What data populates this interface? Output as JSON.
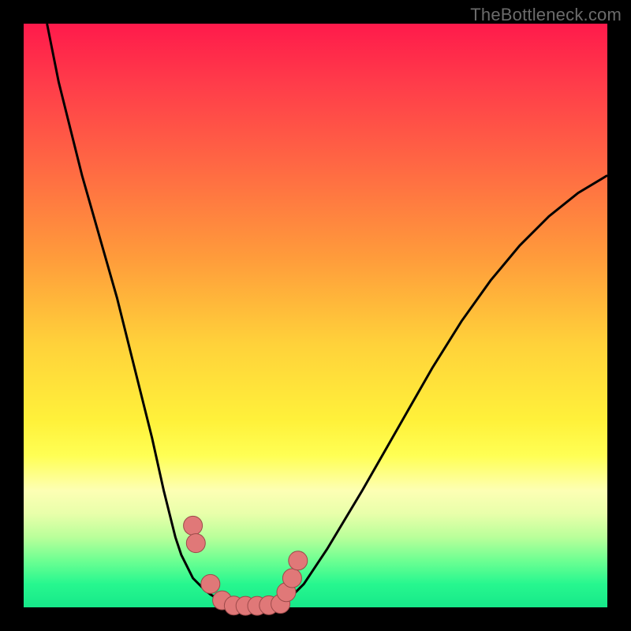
{
  "watermark": {
    "text": "TheBottleneck.com"
  },
  "chart_data": {
    "type": "line",
    "title": "",
    "xlabel": "",
    "ylabel": "",
    "xlim": [
      0,
      100
    ],
    "ylim": [
      0,
      100
    ],
    "grid": false,
    "series": [
      {
        "name": "left-curve",
        "x": [
          4,
          6,
          8,
          10,
          12,
          14,
          16,
          18,
          20,
          22,
          24,
          25,
          26,
          27,
          28,
          29,
          30,
          31,
          32,
          33,
          34,
          35
        ],
        "values": [
          100,
          90,
          82,
          74,
          67,
          60,
          53,
          45,
          37,
          29,
          20,
          16,
          12,
          9,
          7,
          5,
          4,
          3,
          2.2,
          1.6,
          1.0,
          0.6
        ]
      },
      {
        "name": "floor",
        "x": [
          35,
          36,
          37,
          38,
          39,
          40,
          41,
          42,
          43,
          44
        ],
        "values": [
          0.6,
          0.4,
          0.3,
          0.25,
          0.25,
          0.25,
          0.3,
          0.35,
          0.45,
          0.6
        ]
      },
      {
        "name": "right-curve",
        "x": [
          44,
          46,
          48,
          50,
          52,
          55,
          58,
          62,
          66,
          70,
          75,
          80,
          85,
          90,
          95,
          100
        ],
        "values": [
          0.6,
          2,
          4,
          7,
          10,
          15,
          20,
          27,
          34,
          41,
          49,
          56,
          62,
          67,
          71,
          74
        ]
      },
      {
        "name": "markers",
        "x": [
          29,
          29.5,
          32,
          34,
          36,
          38,
          40,
          42,
          44,
          45,
          46,
          47
        ],
        "values": [
          14,
          11,
          4,
          1.2,
          0.3,
          0.25,
          0.25,
          0.35,
          0.6,
          2.6,
          5,
          8
        ]
      }
    ]
  },
  "style": {
    "marker_fill": "#e07878",
    "marker_stroke": "#9c4a4a",
    "curve_stroke": "#000000"
  }
}
